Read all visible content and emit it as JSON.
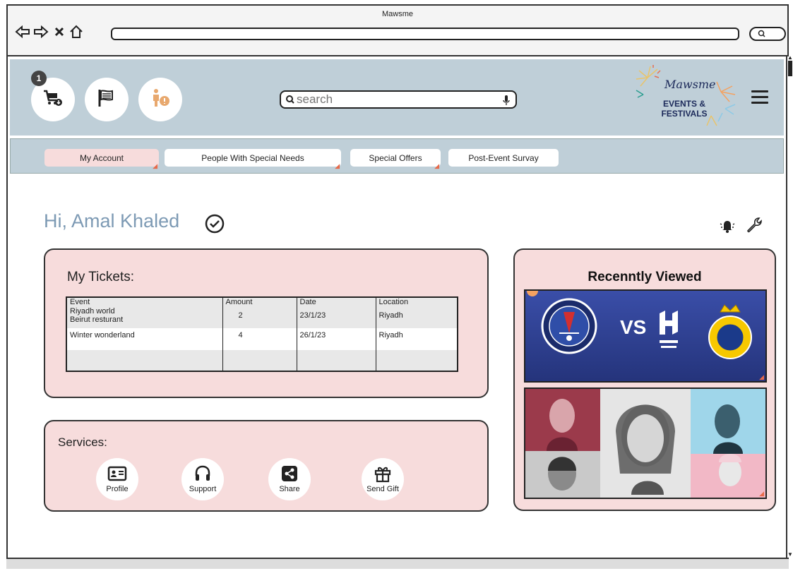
{
  "window": {
    "title": "Mawsme"
  },
  "header": {
    "cart_count": "1",
    "search_placeholder": "search",
    "logo": {
      "script": "Mawsme",
      "line1": "EVENTS &",
      "line2": "FESTIVALS"
    }
  },
  "tabs": [
    {
      "label": "My Account"
    },
    {
      "label": "People With Special Needs"
    },
    {
      "label": "Special Offers"
    },
    {
      "label": "Post-Event Survay"
    }
  ],
  "greeting": "Hi, Amal Khaled",
  "tickets": {
    "title": "My Tickets:",
    "columns": [
      "Event",
      "Amount",
      "Date",
      "Location"
    ],
    "rows": [
      {
        "event_line1": "Riyadh world",
        "event_line2": "Beirut resturant",
        "amount": "2",
        "date": "23/1/23",
        "location": "Riyadh"
      },
      {
        "event_line1": "Winter wonderland",
        "event_line2": "",
        "amount": "4",
        "date": "26/1/23",
        "location": "Riyadh"
      }
    ]
  },
  "services": {
    "title": "Services:",
    "items": [
      {
        "label": "Profile",
        "icon": "id-card-icon"
      },
      {
        "label": "Support",
        "icon": "headphones-icon"
      },
      {
        "label": "Share",
        "icon": "share-icon"
      },
      {
        "label": "Send Gift",
        "icon": "gift-icon"
      }
    ]
  },
  "recent": {
    "title": "Recenntly Viewed",
    "card1": {
      "vs": "VS"
    }
  },
  "colors": {
    "header_bg": "#bfcfd8",
    "panel_bg": "#f7dcdc",
    "greeting": "#7d9ab4",
    "accent_icon": "#e8a86e"
  }
}
